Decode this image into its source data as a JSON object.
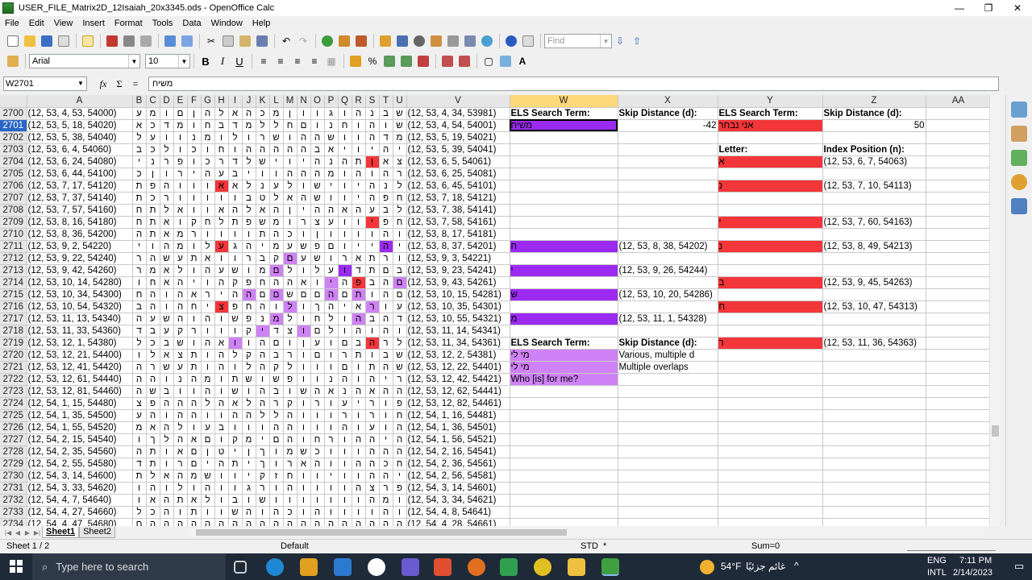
{
  "window": {
    "title": "USER_FILE_Matrix2D_12Isaiah_20x3345.ods - OpenOffice Calc"
  },
  "menu": [
    "File",
    "Edit",
    "View",
    "Insert",
    "Format",
    "Tools",
    "Data",
    "Window",
    "Help"
  ],
  "toolbar": {
    "find_placeholder": "Find",
    "font_name": "Arial",
    "font_size": "10",
    "bold": "B",
    "italic": "I",
    "underline": "U"
  },
  "formula": {
    "cell_ref": "W2701",
    "content": "משיח",
    "sum": "Σ",
    "equals": "=",
    "fx": "fx"
  },
  "columns": [
    "A",
    "B",
    "C",
    "D",
    "E",
    "F",
    "G",
    "H",
    "I",
    "J",
    "K",
    "L",
    "M",
    "N",
    "O",
    "P",
    "Q",
    "R",
    "S",
    "T",
    "U",
    "V",
    "W",
    "X",
    "Y",
    "Z",
    "AA"
  ],
  "selected_row": "2701",
  "rows": [
    {
      "n": "2700",
      "a": "(12, 53, 4, 53, 54000)",
      "letters": [
        "ע",
        "מ",
        "ו",
        "ם",
        "ן",
        "ה",
        "ל",
        "א",
        "ה",
        "כ",
        "מ",
        "ן",
        "ו",
        "ו",
        "ג",
        "ו",
        "ה",
        "נ",
        "ב",
        "ש"
      ],
      "v": "(12, 53, 4, 34, 53981)"
    },
    {
      "n": "2701",
      "a": "(12, 53, 5, 18, 54020)",
      "letters": [
        "א",
        "כ",
        "ד",
        "מ",
        "ו",
        "ח",
        "ב",
        "ד",
        "מ",
        "ל",
        "ל",
        "ח",
        "ם",
        "ו",
        "נ",
        "ח",
        "ו",
        "ה",
        "ו",
        "ש"
      ],
      "v": "(12, 53, 4, 54, 54001)"
    },
    {
      "n": "2702",
      "a": "(12, 53, 5, 38, 54040)",
      "letters": [
        "ל",
        "ע",
        "ו",
        "ו",
        "נ",
        "מ",
        "ו",
        "ל",
        "ו",
        "ר",
        "ש",
        "ו",
        "ה",
        "ה",
        "ש",
        "ו",
        "ו",
        "ה",
        "ד",
        "מ"
      ],
      "v": "(12, 53, 5, 19, 54021)"
    },
    {
      "n": "2703",
      "a": "(12, 53, 6, 4, 54060)",
      "letters": [
        "ב",
        "כ",
        "ל",
        "ו",
        "כ",
        "ו",
        "ח",
        "ו",
        "ה",
        "ה",
        "ה",
        "ה",
        "ה",
        "ב",
        "א",
        "י",
        "ו",
        "י",
        "ה",
        "י"
      ],
      "v": "(12, 53, 5, 39, 54041)"
    },
    {
      "n": "2704",
      "a": "(12, 53, 6, 24, 54080)",
      "letters": [
        "י",
        "נ",
        "ר",
        "פ",
        "ו",
        "כ",
        "ר",
        "ד",
        "ל",
        "ש",
        "י",
        "ו",
        "י",
        "ה",
        "נ",
        "ה",
        "ת",
        "ן",
        "א",
        "צ"
      ],
      "v": "(12, 53, 6, 5, 54061)"
    },
    {
      "n": "2705",
      "a": "(12, 53, 6, 44, 54100)",
      "letters": [
        "כ",
        "ן",
        "ו",
        "ר",
        "י",
        "ה",
        "ע",
        "ב",
        "י",
        "ו",
        "ו",
        "ה",
        "ה",
        "ה",
        "מ",
        "ו",
        "ה",
        "ו",
        "ה",
        "ר"
      ],
      "v": "(12, 53, 6, 25, 54081)"
    },
    {
      "n": "2706",
      "a": "(12, 53, 7, 17, 54120)",
      "letters": [
        "ת",
        "פ",
        "ה",
        "ו",
        "ו",
        "ו",
        "א",
        "א",
        "ל",
        "נ",
        "ע",
        "ל",
        "ו",
        "ש",
        "י",
        "ו",
        "י",
        "ה",
        "נ",
        "ל"
      ],
      "v": "(12, 53, 6, 45, 54101)"
    },
    {
      "n": "2707",
      "a": "(12, 53, 7, 37, 54140)",
      "letters": [
        "ת",
        "כ",
        "ר",
        "ו",
        "ו",
        "ו",
        "ו",
        "ו",
        "ב",
        "ט",
        "ל",
        "א",
        "ה",
        "ש",
        "ו",
        "ו",
        "י",
        "ה",
        "פ",
        "ח"
      ],
      "v": "(12, 53, 7, 18, 54121)"
    },
    {
      "n": "2708",
      "a": "(12, 53, 7, 57, 54160)",
      "letters": [
        "ח",
        "ת",
        "ל",
        "א",
        "ו",
        "ו",
        "א",
        "ה",
        "ל",
        "א",
        "ה",
        "ן",
        "י",
        "ה",
        "ה",
        "א",
        "ה",
        "ע",
        "ב",
        "ל"
      ],
      "v": "(12, 53, 7, 38, 54141)"
    },
    {
      "n": "2709",
      "a": "(12, 53, 8, 16, 54180)",
      "letters": [
        "ח",
        "ת",
        "א",
        "ו",
        "ק",
        "ח",
        "ל",
        "ת",
        "פ",
        "ש",
        "מ",
        "ו",
        "ר",
        "צ",
        "ע",
        "ו",
        "ו",
        "י",
        "פ",
        "ח"
      ],
      "v": "(12, 53, 7, 58, 54161)"
    },
    {
      "n": "2710",
      "a": "(12, 53, 8, 36, 54200)",
      "letters": [
        "ה",
        "ת",
        "א",
        "מ",
        "ר",
        "ו",
        "ו",
        "ו",
        "ו",
        "ת",
        "ה",
        "כ",
        "ו",
        "ן",
        "ו",
        "ו",
        "ו",
        "ו",
        "ה",
        "ו"
      ],
      "v": "(12, 53, 8, 17, 54181)"
    },
    {
      "n": "2711",
      "a": "(12, 53, 9, 2, 54220)",
      "letters": [
        "י",
        "ו",
        "ה",
        "מ",
        "ו",
        "ל",
        "ע",
        "ג",
        "ה",
        "י",
        "מ",
        "ע",
        "ש",
        "פ",
        "ם",
        "ו",
        "י",
        "י",
        "ה",
        "י"
      ],
      "v": "(12, 53, 8, 37, 54201)"
    },
    {
      "n": "2712",
      "a": "(12, 53, 9, 22, 54240)",
      "letters": [
        "ר",
        "ה",
        "ש",
        "ע",
        "ת",
        "א",
        "ו",
        "ו",
        "ר",
        "ב",
        "ק",
        "ם",
        "ע",
        "ש",
        "ו",
        "ר",
        "א",
        "ת",
        "ר",
        "ו"
      ],
      "v": "(12, 53, 9, 3, 54221)"
    },
    {
      "n": "2713",
      "a": "(12, 53, 9, 42, 54260)",
      "letters": [
        "ר",
        "מ",
        "א",
        "ל",
        "ו",
        "ה",
        "ע",
        "ש",
        "ו",
        "מ",
        "ם",
        "ל",
        "ו",
        "ל",
        "ע",
        "ו",
        "ד",
        "ת",
        "ם",
        "ב"
      ],
      "v": "(12, 53, 9, 23, 54241)"
    },
    {
      "n": "2714",
      "a": "(12, 53, 10, 14, 54280)",
      "letters": [
        "ו",
        "ח",
        "א",
        "ה",
        "י",
        "ו",
        "ה",
        "ק",
        "פ",
        "ח",
        "ה",
        "ה",
        "א",
        "ו",
        "י",
        "ה",
        "פ",
        "ב",
        "ה",
        "ם"
      ],
      "v": "(12, 53, 9, 43, 54261)"
    },
    {
      "n": "2715",
      "a": "(12, 53, 10, 34, 54300)",
      "letters": [
        "ח",
        "ה",
        "ו",
        "ה",
        "א",
        "ר",
        "י",
        "ה",
        "ה",
        "ם",
        "ם",
        "ש",
        "ם",
        "ם",
        "ה",
        "ם",
        "ת",
        "ו",
        "ה",
        "ם"
      ],
      "v": "(12, 53, 10, 15, 54281)"
    },
    {
      "n": "2716",
      "a": "(12, 53, 10, 54, 54320)",
      "letters": [
        "ב",
        "ה",
        "ו",
        "ה",
        "ח",
        "י",
        "צ",
        "פ",
        "ח",
        "ה",
        "ו",
        "ל",
        "ו",
        "ך",
        "ה",
        "י",
        "א",
        "ר",
        "ו",
        "ע"
      ],
      "v": "(12, 53, 10, 35, 54301)"
    },
    {
      "n": "2717",
      "a": "(12, 53, 11, 13, 54340)",
      "letters": [
        "ה",
        "ע",
        "ש",
        "ה",
        "ו",
        "ה",
        "ו",
        "ש",
        "פ",
        "נ",
        "מ",
        "ל",
        "ו",
        "ח",
        "ל",
        "ו",
        "ה",
        "ב",
        "ה",
        "ד"
      ],
      "v": "(12, 53, 10, 55, 54321)"
    },
    {
      "n": "2718",
      "a": "(12, 53, 11, 33, 54360)",
      "letters": [
        "ד",
        "ב",
        "ע",
        "ק",
        "ר",
        "ו",
        "ו",
        "ו",
        "ק",
        "י",
        "ד",
        "צ",
        "ו",
        "ם",
        "ל",
        "ו",
        "ה",
        "ו",
        "ה",
        "ו"
      ],
      "v": "(12, 53, 11, 14, 54341)"
    },
    {
      "n": "2719",
      "a": "(12, 53, 12, 1, 54380)",
      "letters": [
        "ל",
        "כ",
        "ב",
        "ש",
        "ו",
        "ה",
        "א",
        "ו",
        "ו",
        "ה",
        "ם",
        "ו",
        "ן",
        "ע",
        "ו",
        "ם",
        "ב",
        "ה",
        "ר",
        "ל"
      ],
      "v": "(12, 53, 11, 34, 54361)"
    },
    {
      "n": "2720",
      "a": "(12, 53, 12, 21, 54400)",
      "letters": [
        "ו",
        "ל",
        "א",
        "צ",
        "ת",
        "ו",
        "ה",
        "ל",
        "ק",
        "ה",
        "ב",
        "ר",
        "ו",
        "ם",
        "ו",
        "ר",
        "ת",
        "ו",
        "ב",
        "ש"
      ],
      "v": "(12, 53, 12, 2, 54381)"
    },
    {
      "n": "2721",
      "a": "(12, 53, 12, 41, 54420)",
      "letters": [
        "ה",
        "ר",
        "ש",
        "ע",
        "ת",
        "ו",
        "ה",
        "ו",
        "ל",
        "ה",
        "ק",
        "ל",
        "ו",
        "ו",
        "ו",
        "ם",
        "ו",
        "ת",
        "ה",
        "ש"
      ],
      "v": "(12, 53, 12, 22, 54401)"
    },
    {
      "n": "2722",
      "a": "(12, 53, 12, 61, 54440)",
      "letters": [
        "ה",
        "ה",
        "ו",
        "נ",
        "ה",
        "מ",
        "ו",
        "ת",
        "ש",
        "ו",
        "ש",
        "פ",
        "ו",
        "ו",
        "נ",
        "ה",
        "ו",
        "ה",
        "י",
        "ר"
      ],
      "v": "(12, 53, 12, 42, 54421)"
    },
    {
      "n": "2723",
      "a": "(12, 53, 12, 81, 54460)",
      "letters": [
        "ה",
        "ש",
        "ב",
        "ו",
        "ו",
        "ה",
        "ו",
        "ש",
        "ו",
        "ה",
        "ב",
        "ו",
        "ש",
        "ה",
        "א",
        "נ",
        "ה",
        "א",
        "ה",
        "ה"
      ],
      "v": "(12, 53, 12, 62, 54441)"
    },
    {
      "n": "2724",
      "a": "(12, 54, 1, 15, 54480)",
      "letters": [
        "צ",
        "פ",
        "ה",
        "ה",
        "ה",
        "ל",
        "ה",
        "א",
        "ל",
        "ה",
        "ר",
        "ק",
        "ו",
        "ר",
        "ו",
        "ע",
        "י",
        "ר",
        "ו",
        "פ"
      ],
      "v": "(12, 53, 12, 82, 54461)"
    },
    {
      "n": "2725",
      "a": "(12, 54, 1, 35, 54500)",
      "letters": [
        "ע",
        "ה",
        "ו",
        "ה",
        "ה",
        "ו",
        "ו",
        "ה",
        "ה",
        "ל",
        "ל",
        "ה",
        "ו",
        "ו",
        "ו",
        "ר",
        "ו",
        "ר",
        "ו",
        "ח"
      ],
      "v": "(12, 54, 1, 16, 54481)"
    },
    {
      "n": "2726",
      "a": "(12, 54, 1, 55, 54520)",
      "letters": [
        "מ",
        "א",
        "ה",
        "ל",
        "ו",
        "ע",
        "ב",
        "ו",
        "ו",
        "ו",
        "ה",
        "ה",
        "ו",
        "ו",
        "ו",
        "ה",
        "ו",
        "ע",
        "ו",
        "ה"
      ],
      "v": "(12, 54, 1, 36, 54501)"
    },
    {
      "n": "2727",
      "a": "(12, 54, 2, 15, 54540)",
      "letters": [
        "ו",
        "ך",
        "ל",
        "ה",
        "א",
        "ם",
        "ו",
        "ק",
        "מ",
        "י",
        "ם",
        "ה",
        "ו",
        "ח",
        "ר",
        "ו",
        "ה",
        "ה",
        "י",
        "ה"
      ],
      "v": "(12, 54, 1, 56, 54521)"
    },
    {
      "n": "2728",
      "a": "(12, 54, 2, 35, 54560)",
      "letters": [
        "ה",
        "ת",
        "ו",
        "א",
        "ם",
        "ן",
        "ט",
        "י",
        "ן",
        "ך",
        "ו",
        "מ",
        "ש",
        "כ",
        "ו",
        "ו",
        "ו",
        "ה",
        "ה",
        "ה"
      ],
      "v": "(12, 54, 2, 16, 54541)"
    },
    {
      "n": "2729",
      "a": "(12, 54, 2, 55, 54580)",
      "letters": [
        "ד",
        "ת",
        "ו",
        "ר",
        "ם",
        "י",
        "ה",
        "ת",
        "י",
        "ך",
        "ו",
        "ר",
        "א",
        "ה",
        "ו",
        "ו",
        "ה",
        "ה",
        "כ",
        "ח"
      ],
      "v": "(12, 54, 2, 36, 54561)"
    },
    {
      "n": "2730",
      "a": "(12, 54, 3, 14, 54600)",
      "letters": [
        "ת",
        "ל",
        "א",
        "ה",
        "מ",
        "ש",
        "ו",
        "ו",
        "י",
        "ק",
        "ז",
        "ח",
        "ו",
        "ו",
        "י",
        "ו",
        "ו",
        "ה",
        "ה",
        "י"
      ],
      "v": "(12, 54, 2, 56, 54581)"
    },
    {
      "n": "2731",
      "a": "(12, 54, 3, 33, 54620)",
      "letters": [
        "ו",
        "ה",
        "ו",
        "ל",
        "ו",
        "ה",
        "ו",
        "ו",
        "ג",
        "ר",
        "ו",
        "ה",
        "ו",
        "ו",
        "ו",
        "ו",
        "ה",
        "צ",
        "ר",
        "פ"
      ],
      "v": "(12, 54, 3, 14, 54601)"
    },
    {
      "n": "2732",
      "a": "(12, 54, 4, 7, 54640)",
      "letters": [
        "ו",
        "א",
        "ה",
        "ת",
        "א",
        "ל",
        "ו",
        "ב",
        "ו",
        "ש",
        "ו",
        "ו",
        "ו",
        "ו",
        "ו",
        "ו",
        "ו",
        "ה",
        "מ",
        "ו"
      ],
      "v": "(12, 54, 3, 34, 54621)"
    },
    {
      "n": "2733",
      "a": "(12, 54, 4, 27, 54660)",
      "letters": [
        "ל",
        "כ",
        "ה",
        "ו",
        "ת",
        "ו",
        "ו",
        "ש",
        "ה",
        "ו",
        "ה",
        "כ",
        "ו",
        "ה",
        "ו",
        "ו",
        "ו",
        "ו",
        "ה",
        "ו"
      ],
      "v": "(12, 54, 4, 8, 54641)"
    },
    {
      "n": "2734",
      "a": "(12, 54, 4, 47, 54680)",
      "letters": [
        "ם",
        "ה",
        "ה",
        "ה",
        "ה",
        "ה",
        "ה",
        "ה",
        "ה",
        "ה",
        "ה",
        "ה",
        "ה",
        "ה",
        "ה",
        "ה",
        "ה",
        "ה",
        "ה",
        "ה"
      ],
      "v": "(12, 54, 4, 28, 54661)"
    }
  ],
  "right": {
    "w_hdr1": "ELS Search Term:",
    "w_val1": "משיח",
    "x_hdr1": "Skip Distance (d):",
    "x_val1": "-42",
    "y_hdr1": "ELS Search Term:",
    "y_val1": "אני נבחר",
    "z_hdr1": "Skip Distance (d):",
    "z_val1": "50",
    "y_letter": "Letter:",
    "z_index": "Index Position (n):",
    "x_pos": [
      "(12, 53, 8, 38, 54202)",
      "(12, 53, 9, 26, 54244)",
      "(12, 53, 10, 20, 54286)",
      "(12, 53, 11, 1, 54328)"
    ],
    "w_letters": [
      "ח",
      "י",
      "ש",
      "מ"
    ],
    "y_letters": [
      "א",
      "נ",
      "י",
      "נ",
      "ב",
      "ח",
      "ר"
    ],
    "z_pos": [
      "(12, 53, 6, 7, 54063)",
      "(12, 53, 7, 10, 54113)",
      "(12, 53, 7, 60, 54163)",
      "(12, 53, 8, 49, 54213)",
      "(12, 53, 9, 45, 54263)",
      "(12, 53, 10, 47, 54313)",
      "(12, 53, 11, 36, 54363)"
    ],
    "w_hdr2": "ELS Search Term:",
    "x_hdr2": "Skip Distance (d):",
    "w_t1": "מי לי",
    "w_t2": "מי לי",
    "w_t3": "Who [is] for me?",
    "x_t1": "Various, multiple d",
    "x_t2": "Multiple overlaps"
  },
  "sheets": [
    "Sheet1",
    "Sheet2"
  ],
  "status": {
    "sheet": "Sheet 1 / 2",
    "style": "Default",
    "mode": "STD",
    "mark": "*",
    "sum": "Sum=0"
  },
  "taskbar": {
    "search": "Type here to search",
    "weather": "54°F",
    "weather_text": "غائم جزئيًا",
    "lang": "ENG",
    "lang2": "INTL",
    "time": "7:11 PM",
    "date": "2/14/2023"
  }
}
